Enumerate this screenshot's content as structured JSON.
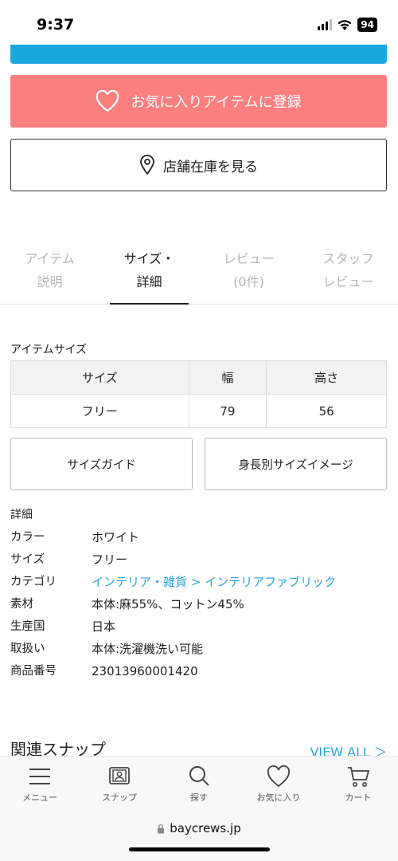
{
  "status": {
    "time": "9:37",
    "battery": "94"
  },
  "actions": {
    "favorite_label": "お気に入りアイテムに登録",
    "store_stock_label": "店舗在庫を見る"
  },
  "tabs": [
    {
      "label": "アイテム\n説明"
    },
    {
      "label": "サイズ・\n詳細"
    },
    {
      "label": "レビュー\n(0件)"
    },
    {
      "label": "スタッフ\nレビュー"
    }
  ],
  "item_size": {
    "title": "アイテムサイズ",
    "headers": [
      "サイズ",
      "幅",
      "高さ"
    ],
    "rows": [
      [
        "フリー",
        "79",
        "56"
      ]
    ]
  },
  "size_buttons": {
    "guide": "サイズガイド",
    "height_image": "身長別サイズイメージ"
  },
  "details": {
    "title": "詳細",
    "rows": [
      {
        "key": "カラー",
        "value": "ホワイト"
      },
      {
        "key": "サイズ",
        "value": "フリー"
      },
      {
        "key": "カテゴリ",
        "value": "インテリア・雑貨 > インテリアファブリック"
      },
      {
        "key": "素材",
        "value": "本体:麻55%、コットン45%"
      },
      {
        "key": "生産国",
        "value": "日本"
      },
      {
        "key": "取扱い",
        "value": "本体:洗濯機洗い可能"
      },
      {
        "key": "商品番号",
        "value": "23013960001420"
      }
    ]
  },
  "related": {
    "title": "関連スナップ",
    "view_all": "VIEW ALL ＞"
  },
  "bottom_nav": [
    {
      "label": "メニュー",
      "icon": "menu-icon"
    },
    {
      "label": "スナップ",
      "icon": "snap-icon"
    },
    {
      "label": "探す",
      "icon": "search-icon"
    },
    {
      "label": "お気に入り",
      "icon": "heart-icon"
    },
    {
      "label": "カート",
      "icon": "cart-icon"
    }
  ],
  "browser": {
    "url": "baycrews.jp"
  },
  "colors": {
    "favorite": "#fb7f7f",
    "link": "#2ba3dc",
    "top_button": "#1aa7e0"
  }
}
